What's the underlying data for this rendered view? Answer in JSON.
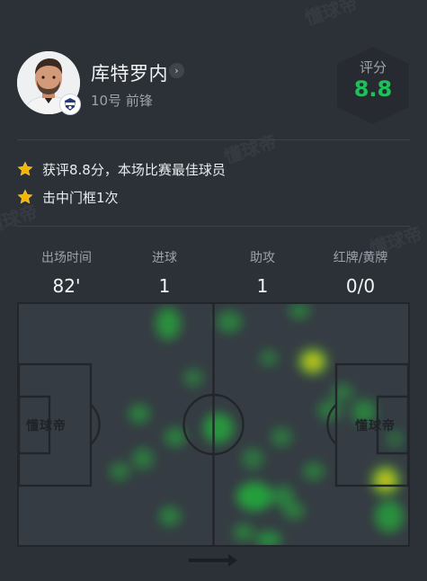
{
  "watermark_text": "懂球帝",
  "player": {
    "name": "库特罗内",
    "meta": "10号 前锋",
    "rating_label": "评分",
    "rating_value": "8.8"
  },
  "highlights": [
    {
      "icon": "star-icon",
      "text": "获评8.8分，本场比赛最佳球员"
    },
    {
      "icon": "star-icon",
      "text": "击中门框1次"
    }
  ],
  "stats": [
    {
      "label": "出场时间",
      "value": "82'"
    },
    {
      "label": "进球",
      "value": "1"
    },
    {
      "label": "助攻",
      "value": "1"
    },
    {
      "label": "红牌/黄牌",
      "value": "0/0"
    }
  ],
  "heatmap": {
    "goal_logo_text": "懂球帝",
    "direction": "attacking-right",
    "colors": {
      "cold": "#1fbf3b",
      "hot": "#f0a020"
    }
  },
  "colors": {
    "accent_green": "#1fbf5b",
    "star": "#f5b400"
  }
}
